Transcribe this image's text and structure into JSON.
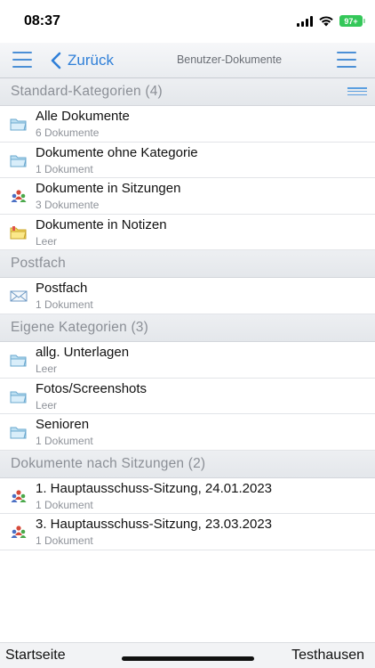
{
  "status_bar": {
    "time": "08:37",
    "battery": "97+"
  },
  "nav": {
    "back_label": "Zurück",
    "title": "Benutzer-Dokumente"
  },
  "sections": [
    {
      "header": "Standard-Kategorien (4)",
      "items": [
        {
          "title": "Alle Dokumente",
          "subtitle": "6 Dokumente",
          "icon": "folder-icon"
        },
        {
          "title": "Dokumente ohne Kategorie",
          "subtitle": "1 Dokument",
          "icon": "folder-icon"
        },
        {
          "title": "Dokumente in Sitzungen",
          "subtitle": "3 Dokumente",
          "icon": "people-icon"
        },
        {
          "title": "Dokumente in Notizen",
          "subtitle": "Leer",
          "icon": "notes-folder-icon"
        }
      ]
    },
    {
      "header": "Postfach",
      "items": [
        {
          "title": "Postfach",
          "subtitle": "1 Dokument",
          "icon": "envelope-icon"
        }
      ]
    },
    {
      "header": "Eigene Kategorien (3)",
      "items": [
        {
          "title": "allg. Unterlagen",
          "subtitle": "Leer",
          "icon": "folder-icon"
        },
        {
          "title": "Fotos/Screenshots",
          "subtitle": "Leer",
          "icon": "folder-icon"
        },
        {
          "title": "Senioren",
          "subtitle": "1 Dokument",
          "icon": "folder-icon"
        }
      ]
    },
    {
      "header": "Dokumente nach Sitzungen (2)",
      "items": [
        {
          "title": "1. Hauptausschuss-Sitzung, 24.01.2023",
          "subtitle": "1 Dokument",
          "icon": "people-icon"
        },
        {
          "title": "3. Hauptausschuss-Sitzung, 23.03.2023",
          "subtitle": "1 Dokument",
          "icon": "people-icon"
        }
      ]
    }
  ],
  "bottom_bar": {
    "left": "Startseite",
    "right": "Testhausen"
  },
  "colors": {
    "accent": "#2f7fd8",
    "battery": "#34c759",
    "section_text": "#8b8f96"
  }
}
